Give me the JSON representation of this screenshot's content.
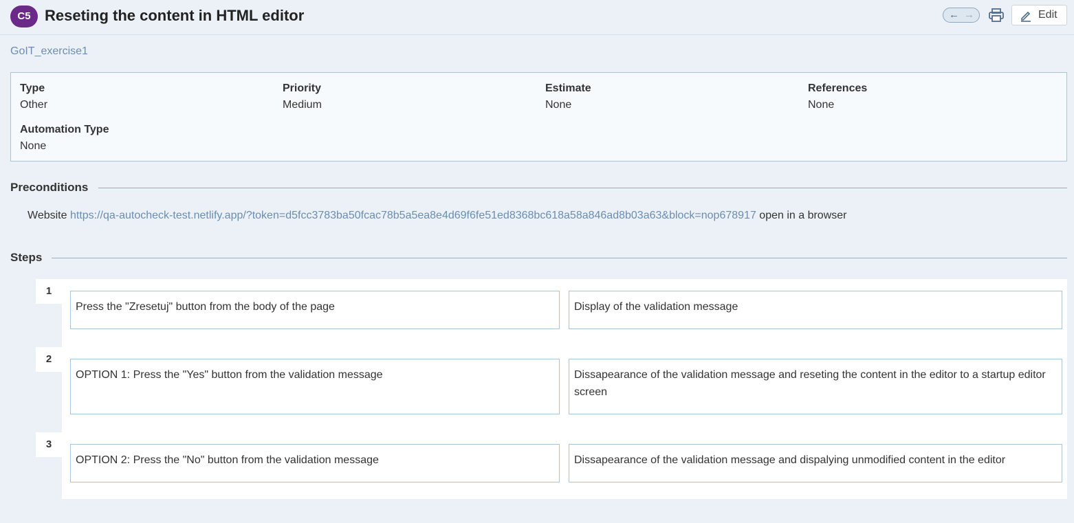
{
  "header": {
    "badge": "C5",
    "title": "Reseting the content in HTML editor",
    "edit_label": "Edit"
  },
  "section_link": "GoIT_exercise1",
  "properties": [
    {
      "key": "Type",
      "value": "Other"
    },
    {
      "key": "Priority",
      "value": "Medium"
    },
    {
      "key": "Estimate",
      "value": "None"
    },
    {
      "key": "References",
      "value": "None"
    },
    {
      "key": "Automation Type",
      "value": "None"
    }
  ],
  "preconditions": {
    "heading": "Preconditions",
    "prefix": "Website",
    "link": "https://qa-autocheck-test.netlify.app/?token=d5fcc3783ba50fcac78b5a5ea8e4d69f6fe51ed8368bc618a58a846ad8b03a63&block=nop678917",
    "suffix": "open in a browser"
  },
  "steps": {
    "heading": "Steps",
    "items": [
      {
        "number": "1",
        "action": "Press the \"Zresetuj\" button from the body of the page",
        "expected": "Display of the validation message"
      },
      {
        "number": "2",
        "action": "OPTION 1: Press the \"Yes\" button from the validation message",
        "expected": "Dissapearance of the validation message and reseting the content in the editor to a startup editor screen"
      },
      {
        "number": "3",
        "action": "OPTION 2: Press the \"No\" button from the validation message",
        "expected": "Dissapearance of the validation message and dispalying unmodified content in the editor"
      }
    ]
  },
  "colors": {
    "badge": "#6b2a87",
    "link": "#6a8db1",
    "background": "#ebf1f7"
  },
  "icons": [
    "arrow-left-icon",
    "arrow-right-icon",
    "print-icon",
    "pencil-icon"
  ]
}
